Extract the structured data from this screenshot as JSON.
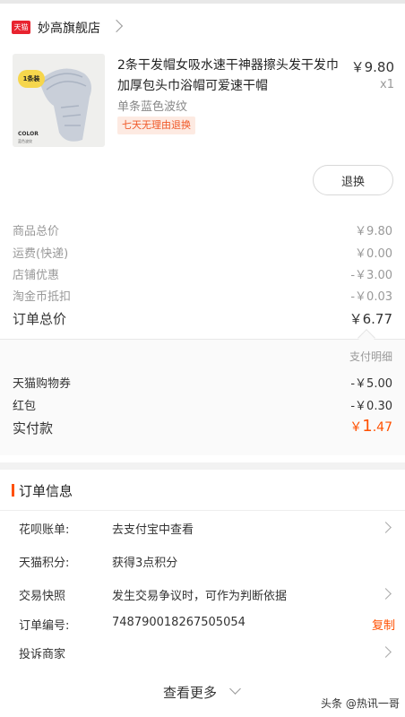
{
  "store": {
    "logo_text": "天猫",
    "name": "妙高旗舰店"
  },
  "product": {
    "thumb_badge": "1条装",
    "thumb_color_label": "COLOR",
    "thumb_color_sub": "蓝色波纹",
    "title": "2条干发帽女吸水速干神器擦头发干发巾加厚包头巾浴帽可爱速干帽",
    "price": "￥9.80",
    "quantity": "x1",
    "sku": "单条蓝色波纹",
    "tag": "七天无理由退换",
    "refund_button": "退换"
  },
  "costs": [
    {
      "label": "商品总价",
      "value": "￥9.80"
    },
    {
      "label": "运费(快递)",
      "value": "￥0.00"
    },
    {
      "label": "店铺优惠",
      "value": "-￥3.00"
    },
    {
      "label": "淘金币抵扣",
      "value": "-￥0.03"
    }
  ],
  "order_total": {
    "label": "订单总价",
    "value": "￥6.77"
  },
  "payment": {
    "detail_label": "支付明细",
    "rows": [
      {
        "label": "天猫购物券",
        "value": "-￥5.00"
      },
      {
        "label": "红包",
        "value": "-￥0.30"
      }
    ],
    "paid_label": "实付款",
    "paid_currency": "￥",
    "paid_int": "1",
    "paid_dec": ".47"
  },
  "order_info": {
    "title": "订单信息",
    "rows": [
      {
        "label": "花呗账单:",
        "value": "去支付宝中查看"
      },
      {
        "label": "天猫积分:",
        "value": "获得3点积分"
      },
      {
        "label": "交易快照",
        "value": "发生交易争议时，可作为判断依据"
      },
      {
        "label": "订单编号:",
        "value": "748790018267505054",
        "action": "复制"
      },
      {
        "label": "投诉商家",
        "value": ""
      }
    ],
    "see_more": "查看更多",
    "watermark": "头条 @热讯一哥"
  },
  "colors": {
    "accent": "#ff5000",
    "tmall_red": "#e8232f"
  }
}
